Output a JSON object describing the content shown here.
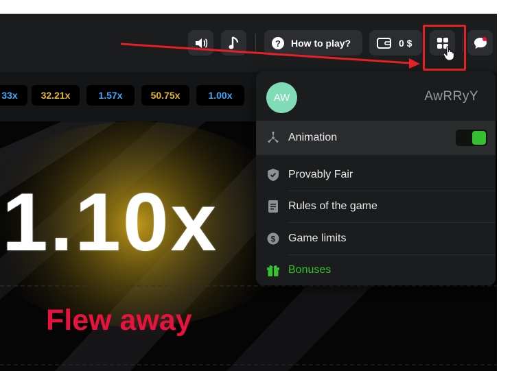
{
  "toolbar": {
    "sound_icon": "speaker-icon",
    "music_icon": "music-note-icon",
    "how_to_play_label": "How to play?",
    "balance_label": "0 $",
    "menu_icon": "grid-menu-icon",
    "chat_icon": "chat-icon"
  },
  "history": {
    "chips": [
      {
        "value": "33x",
        "color": "#3fa9ff"
      },
      {
        "value": "32.21x",
        "color": "#e6b82e"
      },
      {
        "value": "1.57x",
        "color": "#3fa9ff"
      },
      {
        "value": "50.75x",
        "color": "#e6b82e"
      },
      {
        "value": "1.00x",
        "color": "#3fa9ff"
      }
    ]
  },
  "game": {
    "multiplier": "1.10x",
    "status": "Flew away"
  },
  "menu": {
    "avatar_initials": "AW",
    "username": "AwRRyY",
    "animation": {
      "label": "Animation",
      "enabled": true
    },
    "items": [
      {
        "label": "Provably Fair",
        "icon": "shield-icon"
      },
      {
        "label": "Rules of the game",
        "icon": "document-icon"
      },
      {
        "label": "Game limits",
        "icon": "dollar-coin-icon"
      },
      {
        "label": "Bonuses",
        "icon": "gift-icon",
        "color": "#35c12f"
      }
    ]
  },
  "colors": {
    "accent_green": "#35c12f",
    "flew_away_red": "#e8123f",
    "annotation_red": "#e52125"
  }
}
